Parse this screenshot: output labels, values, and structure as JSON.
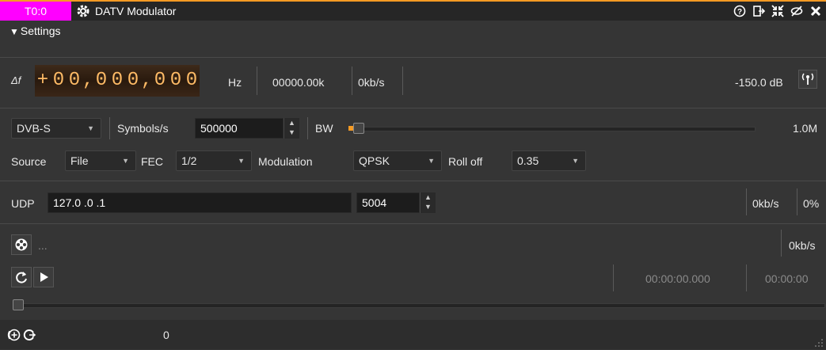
{
  "titlebar": {
    "badge": "T0:0",
    "badge_color": "#ff00ff",
    "title": "DATV Modulator",
    "icons": [
      "help-icon",
      "move-to-workspace-icon",
      "shrink-icon",
      "hide-icon",
      "close-icon"
    ]
  },
  "settings": {
    "label": "Settings"
  },
  "frequency": {
    "delta_label": "Δf",
    "digits": [
      "+",
      "0",
      "0",
      ",",
      "0",
      "0",
      "0",
      ",",
      "0",
      "0",
      "0"
    ],
    "unit": "Hz",
    "readout": "00000.00k",
    "rate": "0kb/s",
    "level": "-150.0 dB"
  },
  "config": {
    "standard": "DVB-S",
    "symbols_label": "Symbols/s",
    "symbols_value": "500000",
    "bw_label": "BW",
    "bw_value": "1.0M",
    "source_label": "Source",
    "source_value": "File",
    "fec_label": "FEC",
    "fec_value": "1/2",
    "modulation_label": "Modulation",
    "modulation_value": "QPSK",
    "rolloff_label": "Roll off",
    "rolloff_value": "0.35"
  },
  "udp": {
    "label": "UDP",
    "address": "127.0 .0 .1",
    "port": "5004",
    "rate": "0kb/s",
    "percent": "0%"
  },
  "file": {
    "name": "...",
    "rate": "0kb/s",
    "elapsed": "00:00:00.000",
    "total": "00:00:00"
  },
  "status": {
    "value": "0"
  }
}
